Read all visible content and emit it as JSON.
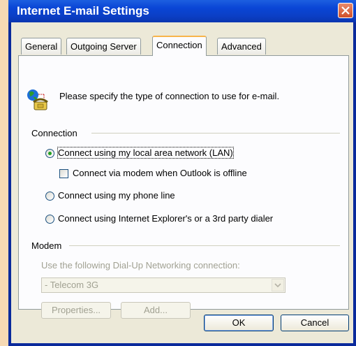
{
  "window": {
    "title": "Internet E-mail Settings"
  },
  "tabs": [
    {
      "label": "General",
      "active": false
    },
    {
      "label": "Outgoing Server",
      "active": false
    },
    {
      "label": "Connection",
      "active": true
    },
    {
      "label": "Advanced",
      "active": false
    }
  ],
  "intro_text": "Please specify the type of connection to use for e-mail.",
  "connection": {
    "group_label": "Connection",
    "options": [
      {
        "label": "Connect using my local area network (LAN)",
        "selected": true
      },
      {
        "label": "Connect via modem when Outlook is offline",
        "checked": false
      },
      {
        "label": "Connect using my phone line",
        "selected": false
      },
      {
        "label": "Connect using Internet Explorer's or a 3rd party dialer",
        "selected": false
      }
    ]
  },
  "modem": {
    "group_label": "Modem",
    "dialup_label": "Use the following Dial-Up Networking connection:",
    "dialup_value": "- Telecom 3G",
    "properties_label": "Properties...",
    "add_label": "Add..."
  },
  "footer": {
    "ok_label": "OK",
    "cancel_label": "Cancel"
  },
  "icons": {
    "close": "close-icon",
    "connection": "globe-phone-icon",
    "dropdown": "chevron-down-icon"
  },
  "colors": {
    "titlebar": "#0a46d6",
    "client": "#ece9d8",
    "selected_radio": "#21a121",
    "active_tab_accent": "#f7b44a"
  }
}
